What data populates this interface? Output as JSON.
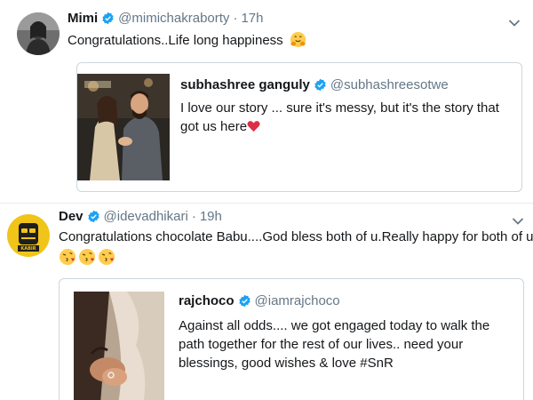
{
  "tweets": [
    {
      "name": "Mimi",
      "handle": "@mimichakraborty",
      "separator": "·",
      "time": "17h",
      "text": "Congratulations..Life long happiness",
      "text_emoji": "hugging-face",
      "quoted": {
        "name": "subhashree ganguly",
        "handle": "@subhashreesotwe",
        "text": "I love our story ... sure it's messy, but it's the story that got us here",
        "text_emoji": "red-heart"
      }
    },
    {
      "name": "Dev",
      "handle": "@idevadhikari",
      "separator": "·",
      "time": "19h",
      "text": "Congratulations chocolate Babu....God bless both of u.Really happy for both of u",
      "emojis": [
        "face-blowing-kiss",
        "face-blowing-kiss",
        "face-blowing-kiss"
      ],
      "avatar_label": "KABIR",
      "quoted": {
        "name": "rajchoco",
        "handle": "@iamrajchoco",
        "text": "Against all odds.... we got engaged today to walk the path together for the rest of our lives.. need your blessings, good wishes & love #SnR"
      }
    }
  ],
  "colors": {
    "verified": "#1da1f2",
    "secondary_text": "#657786",
    "border": "#ccd6dd",
    "heart": "#dd2e44",
    "emoji_yellow": "#ffcc4d"
  }
}
